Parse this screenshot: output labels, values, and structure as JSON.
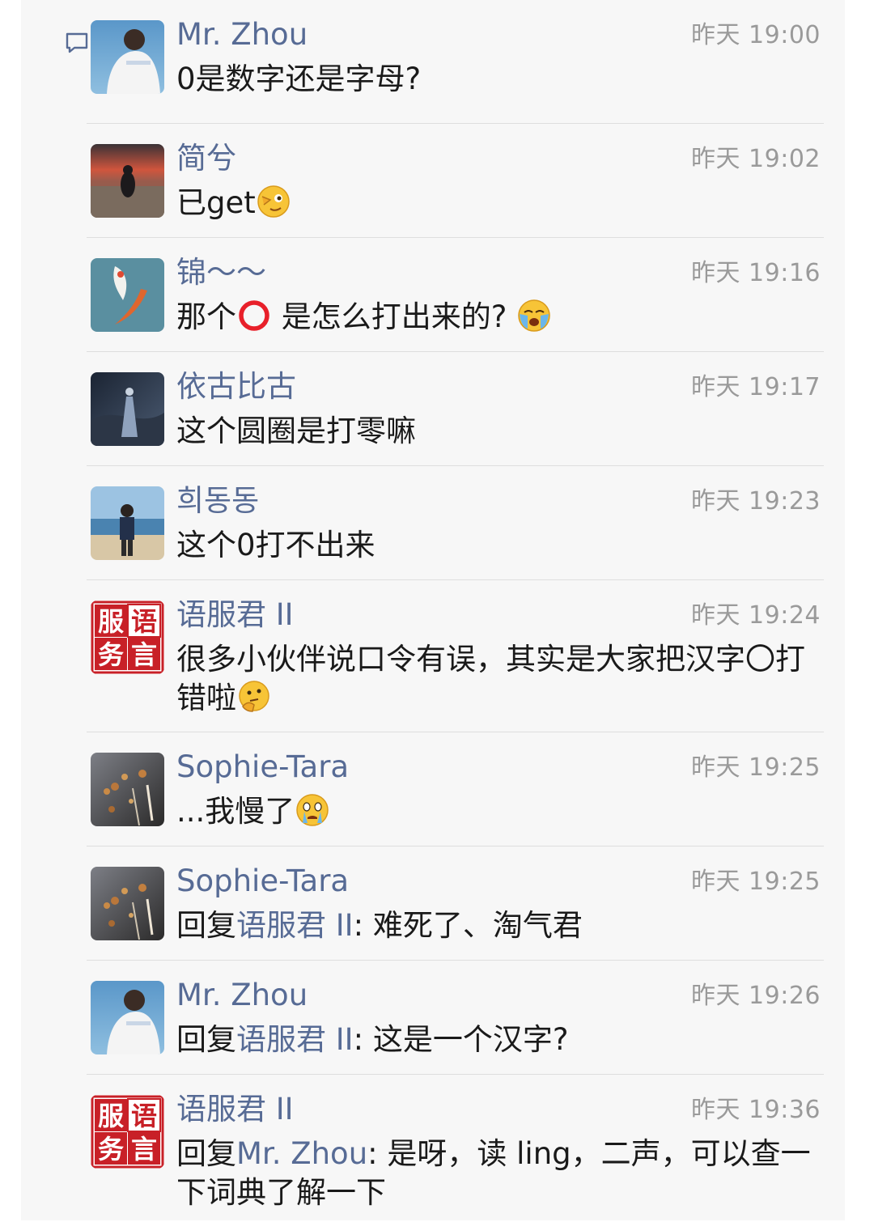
{
  "colors": {
    "name_link": "#576b95",
    "timestamp": "#9a9a9a",
    "text": "#1a1a1a",
    "divider": "#dedede",
    "background": "#f7f7f7",
    "red_circle": "#e8202a"
  },
  "header": {
    "icon": "comment-bubble-icon"
  },
  "comments": [
    {
      "avatar": "avatar-man-white-shirt",
      "name": "Mr. Zhou",
      "time": "昨天 19:00",
      "parts": [
        {
          "t": "0是数字还是字母?"
        }
      ]
    },
    {
      "avatar": "avatar-sunset-beach",
      "name": "简兮",
      "time": "昨天 19:02",
      "parts": [
        {
          "t": "已get"
        },
        {
          "emoji": "wink-hand-emoji"
        }
      ]
    },
    {
      "avatar": "avatar-koi-fish",
      "name": "锦～～",
      "time": "昨天 19:16",
      "parts": [
        {
          "t": "那个"
        },
        {
          "emoji": "heavy-red-circle-emoji"
        },
        {
          "t": " 是怎么打出来的? "
        },
        {
          "emoji": "loudly-crying-face-emoji"
        }
      ]
    },
    {
      "avatar": "avatar-dark-night-figure",
      "name": "依古比古",
      "time": "昨天 19:17",
      "parts": [
        {
          "t": "这个圆圈是打零嘛"
        }
      ]
    },
    {
      "avatar": "avatar-man-on-beach",
      "name": "희동동",
      "time": "昨天 19:23",
      "parts": [
        {
          "t": "这个0打不出来"
        }
      ]
    },
    {
      "avatar": "avatar-fuwu-yuyan-logo",
      "avatar_text": [
        "服",
        "语",
        "务",
        "言"
      ],
      "name": "语服君 II",
      "time": "昨天 19:24",
      "parts": [
        {
          "t": "很多小伙伴说口令有误，其实是大家把汉字〇打错啦"
        },
        {
          "emoji": "thinking-face-emoji"
        }
      ]
    },
    {
      "avatar": "avatar-sparkling-lights",
      "name": "Sophie-Tara",
      "time": "昨天 19:25",
      "parts": [
        {
          "t": "...我慢了"
        },
        {
          "emoji": "crying-face-emoji"
        }
      ]
    },
    {
      "avatar": "avatar-sparkling-lights",
      "name": "Sophie-Tara",
      "time": "昨天 19:25",
      "parts": [
        {
          "t": "回复"
        },
        {
          "m": "语服君 II"
        },
        {
          "t": ": 难死了、淘气君"
        }
      ]
    },
    {
      "avatar": "avatar-man-white-shirt",
      "name": "Mr. Zhou",
      "time": "昨天 19:26",
      "parts": [
        {
          "t": "回复"
        },
        {
          "m": "语服君 II"
        },
        {
          "t": ": 这是一个汉字?"
        }
      ]
    },
    {
      "avatar": "avatar-fuwu-yuyan-logo",
      "avatar_text": [
        "服",
        "语",
        "务",
        "言"
      ],
      "name": "语服君 II",
      "time": "昨天 19:36",
      "parts": [
        {
          "t": "回复"
        },
        {
          "m": "Mr. Zhou"
        },
        {
          "t": ": 是呀，读 ling，二声，可以查一下词典了解一下"
        }
      ]
    }
  ]
}
